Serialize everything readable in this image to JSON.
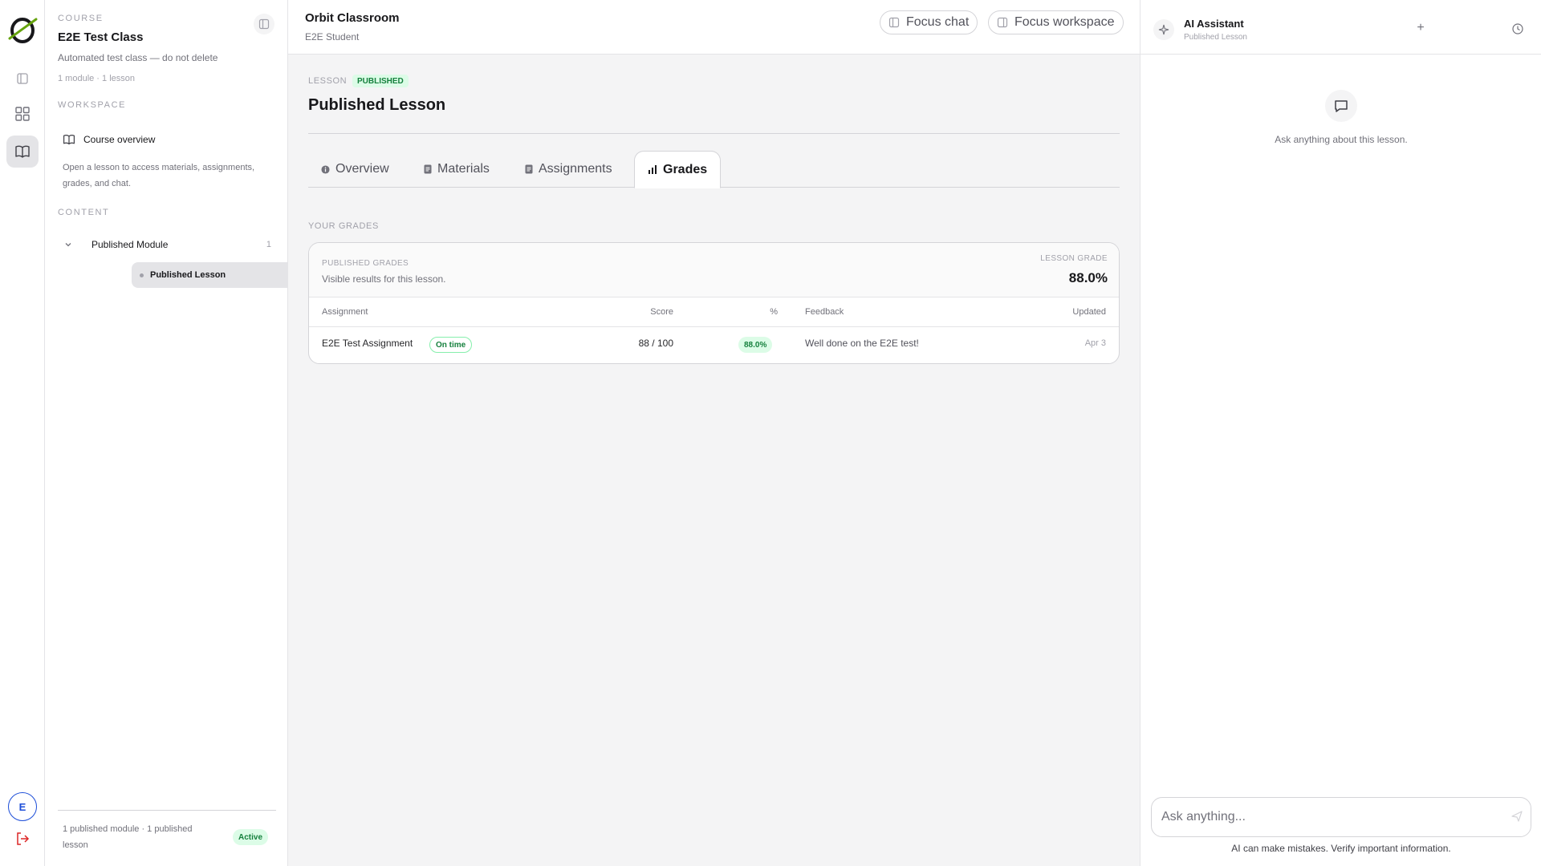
{
  "rail": {
    "avatar_initial": "E"
  },
  "sidebar": {
    "course_eyebrow": "COURSE",
    "course_title": "E2E Test Class",
    "course_description": "Automated test class — do not delete",
    "course_meta": "1 module · 1 lesson",
    "workspace_eyebrow": "WORKSPACE",
    "course_overview_label": "Course overview",
    "help_text": "Open a lesson to access materials, assignments, grades, and chat.",
    "content_eyebrow": "CONTENT",
    "module": {
      "name": "Published Module",
      "count": "1"
    },
    "lesson": {
      "name": "Published Lesson"
    },
    "footer_text": "1 published module · 1 published lesson",
    "status_badge": "Active"
  },
  "topbar": {
    "title": "Orbit Classroom",
    "subtitle": "E2E Student",
    "focus_chat_label": "Focus chat",
    "focus_workspace_label": "Focus workspace"
  },
  "lesson": {
    "label": "LESSON",
    "badge": "PUBLISHED",
    "title": "Published Lesson"
  },
  "tabs": [
    {
      "label": "Overview",
      "icon": "info-icon"
    },
    {
      "label": "Materials",
      "icon": "document-icon"
    },
    {
      "label": "Assignments",
      "icon": "document-icon"
    },
    {
      "label": "Grades",
      "icon": "bar-chart-icon",
      "active": true
    }
  ],
  "grades": {
    "section_title": "YOUR GRADES",
    "card_eyebrow": "PUBLISHED GRADES",
    "card_subtitle": "Visible results for this lesson.",
    "lesson_grade_label": "LESSON GRADE",
    "lesson_grade_value": "88.0%",
    "columns": [
      "Assignment",
      "Score",
      "%",
      "Feedback",
      "Updated"
    ],
    "rows": [
      {
        "assignment": "E2E Test Assignment",
        "status": "On time",
        "score": "88 / 100",
        "percent": "88.0%",
        "feedback": "Well done on the E2E test!",
        "updated": "Apr 3"
      }
    ]
  },
  "assistant": {
    "title": "AI Assistant",
    "subtitle": "Published Lesson",
    "empty_text": "Ask anything about this lesson.",
    "input_placeholder": "Ask anything...",
    "disclaimer": "AI can make mistakes. Verify important information."
  },
  "colors": {
    "accent_green": "#15803d",
    "green_bg": "#dcfce7",
    "avatar_blue": "#1d4ed8",
    "logout_red": "#dc2626"
  }
}
